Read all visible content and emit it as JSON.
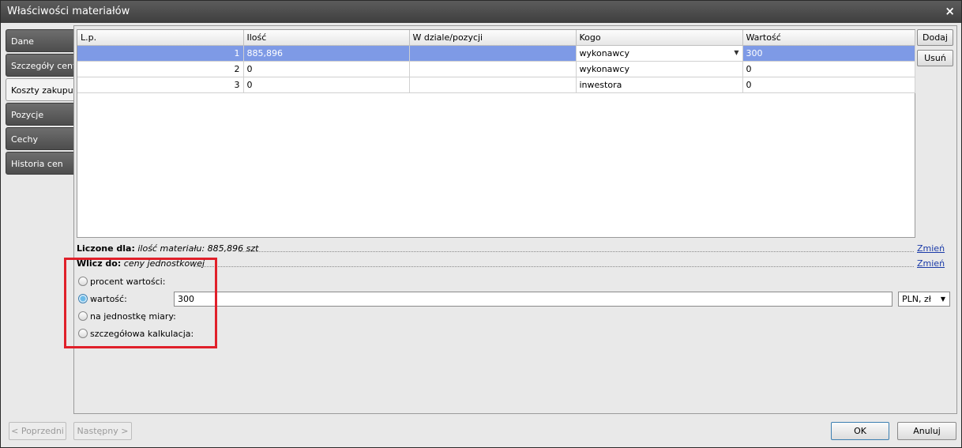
{
  "window": {
    "title": "Właściwości materiałów",
    "close_glyph": "×"
  },
  "tabs": [
    {
      "label": "Dane",
      "active": false
    },
    {
      "label": "Szczegóły ceny",
      "active": false
    },
    {
      "label": "Koszty zakupu",
      "active": true
    },
    {
      "label": "Pozycje",
      "active": false
    },
    {
      "label": "Cechy",
      "active": false
    },
    {
      "label": "Historia cen",
      "active": false
    }
  ],
  "grid": {
    "columns": [
      "L.p.",
      "Ilość",
      "W dziale/pozycji",
      "Kogo",
      "Wartość"
    ],
    "rows": [
      {
        "lp": "1",
        "ilosc": "885,896",
        "dzial": "",
        "kogo": "wykonawcy",
        "wartosc": "300"
      },
      {
        "lp": "2",
        "ilosc": "0",
        "dzial": "",
        "kogo": "wykonawcy",
        "wartosc": "0"
      },
      {
        "lp": "3",
        "ilosc": "0",
        "dzial": "",
        "kogo": "inwestora",
        "wartosc": "0"
      }
    ]
  },
  "side_buttons": {
    "add": "Dodaj",
    "remove": "Usuń"
  },
  "liczone": {
    "label": "Liczone dla:",
    "value": "ilość materiału: 885,896 szt",
    "link": "Zmień"
  },
  "wlicz": {
    "label": "Wlicz do:",
    "value": "ceny jednostkowej",
    "link": "Zmień"
  },
  "options": {
    "procent": "procent wartości:",
    "wartosc": "wartość:",
    "jednostka": "na jednostkę miary:",
    "kalkulacja": "szczegółowa kalkulacja:",
    "selected": "wartosc"
  },
  "value_input": "300",
  "currency": "PLN, zł",
  "footer": {
    "prev": "< Poprzedni",
    "next": "Następny >",
    "ok": "OK",
    "cancel": "Anuluj"
  }
}
